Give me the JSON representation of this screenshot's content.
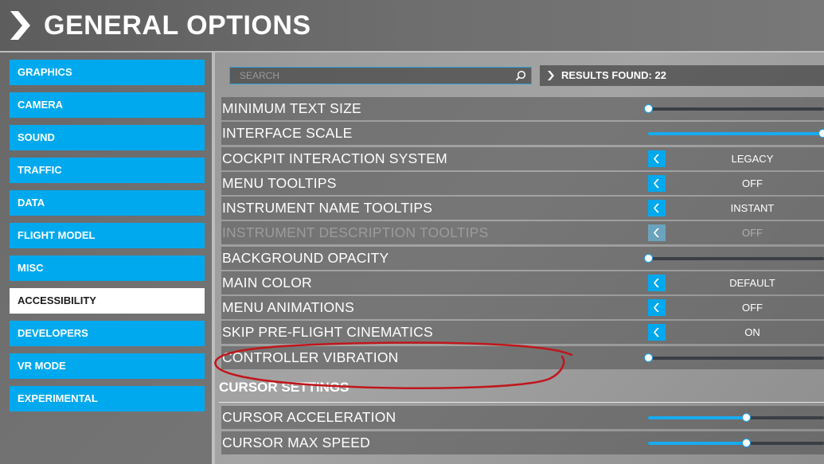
{
  "header": {
    "title": "GENERAL OPTIONS"
  },
  "sidebar": {
    "items": [
      {
        "label": "GRAPHICS",
        "active": false
      },
      {
        "label": "CAMERA",
        "active": false
      },
      {
        "label": "SOUND",
        "active": false
      },
      {
        "label": "TRAFFIC",
        "active": false
      },
      {
        "label": "DATA",
        "active": false
      },
      {
        "label": "FLIGHT MODEL",
        "active": false
      },
      {
        "label": "MISC",
        "active": false
      },
      {
        "label": "ACCESSIBILITY",
        "active": true
      },
      {
        "label": "DEVELOPERS",
        "active": false
      },
      {
        "label": "VR MODE",
        "active": false
      },
      {
        "label": "EXPERIMENTAL",
        "active": false
      }
    ]
  },
  "search": {
    "placeholder": "SEARCH",
    "value": ""
  },
  "results": {
    "label": "RESULTS FOUND: 22"
  },
  "settings": [
    {
      "label": "MINIMUM TEXT SIZE",
      "control": "slider",
      "level": 0.0
    },
    {
      "label": "INTERFACE SCALE",
      "control": "slider",
      "level": 1.0
    },
    {
      "label": "COCKPIT INTERACTION SYSTEM",
      "control": "toggle",
      "value": "LEGACY"
    },
    {
      "label": "MENU TOOLTIPS",
      "control": "toggle",
      "value": "OFF"
    },
    {
      "label": "INSTRUMENT NAME TOOLTIPS",
      "control": "toggle",
      "value": "INSTANT"
    },
    {
      "label": "INSTRUMENT DESCRIPTION TOOLTIPS",
      "control": "toggle",
      "value": "OFF",
      "disabled": true
    },
    {
      "label": "BACKGROUND OPACITY",
      "control": "slider",
      "level": 0.0
    },
    {
      "label": "MAIN COLOR",
      "control": "toggle",
      "value": "DEFAULT"
    },
    {
      "label": "MENU ANIMATIONS",
      "control": "toggle",
      "value": "OFF"
    },
    {
      "label": "SKIP PRE-FLIGHT CINEMATICS",
      "control": "toggle",
      "value": "ON"
    },
    {
      "label": "CONTROLLER VIBRATION",
      "control": "slider",
      "level": 0.0,
      "annotated": true
    }
  ],
  "cursor_section": {
    "title": "CURSOR SETTINGS",
    "settings": [
      {
        "label": "CURSOR ACCELERATION",
        "control": "slider",
        "level": 0.56
      },
      {
        "label": "CURSOR MAX SPEED",
        "control": "slider",
        "level": 0.56
      }
    ]
  },
  "colors": {
    "accent": "#00a9ee",
    "annotation": "#c0161b"
  },
  "icons": {
    "header": "chevron-right-icon",
    "search": "search-icon",
    "results": "chevron-right-icon",
    "toggle": "chevron-left-icon"
  }
}
